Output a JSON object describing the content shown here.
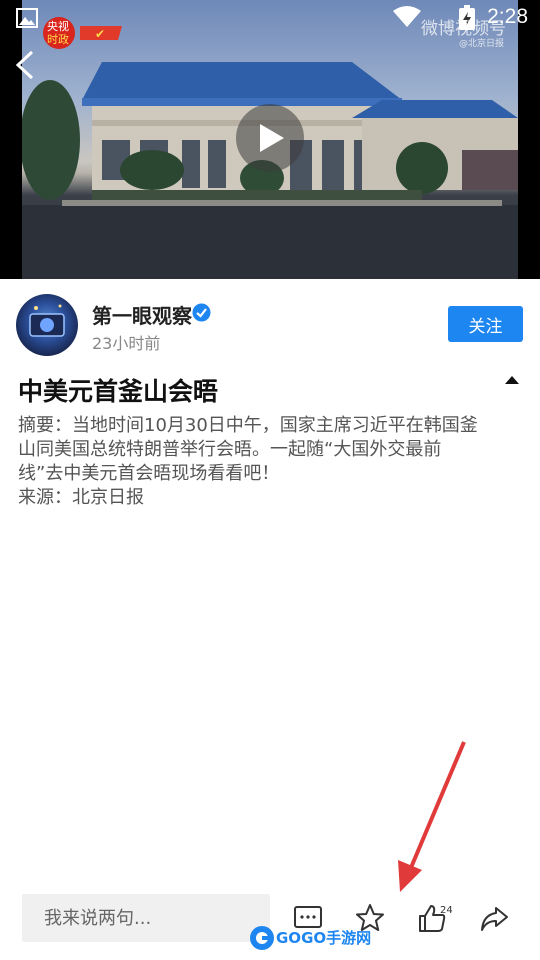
{
  "status_bar": {
    "time": "2:28"
  },
  "video": {
    "badge": {
      "top": "央视",
      "bottom": "时政"
    },
    "watermark": {
      "main": "微博视频号",
      "sub": "@北京日报"
    }
  },
  "author": {
    "name": "第一眼观察",
    "time": "23小时前",
    "follow_label": "关注"
  },
  "article": {
    "title": "中美元首釜山会晤",
    "summary_lines": [
      "摘要：当地时间10月30日中午，国家主席习近平在韩国釜",
      "山同美国总统特朗普举行会晤。一起随“大国外交最前",
      "线”去中美元首会晤现场看看吧！",
      "来源：北京日报"
    ]
  },
  "bottom_bar": {
    "comment_placeholder": "我来说两句...",
    "like_count": "24",
    "icons": [
      "comment-icon",
      "star-icon",
      "thumbs-up-icon",
      "share-icon"
    ]
  },
  "overlay": {
    "site_logo": "GOGO手游网"
  },
  "colors": {
    "accent": "#1e86f0",
    "arrow": "#e03a3a",
    "verified": "#1e86f0"
  }
}
